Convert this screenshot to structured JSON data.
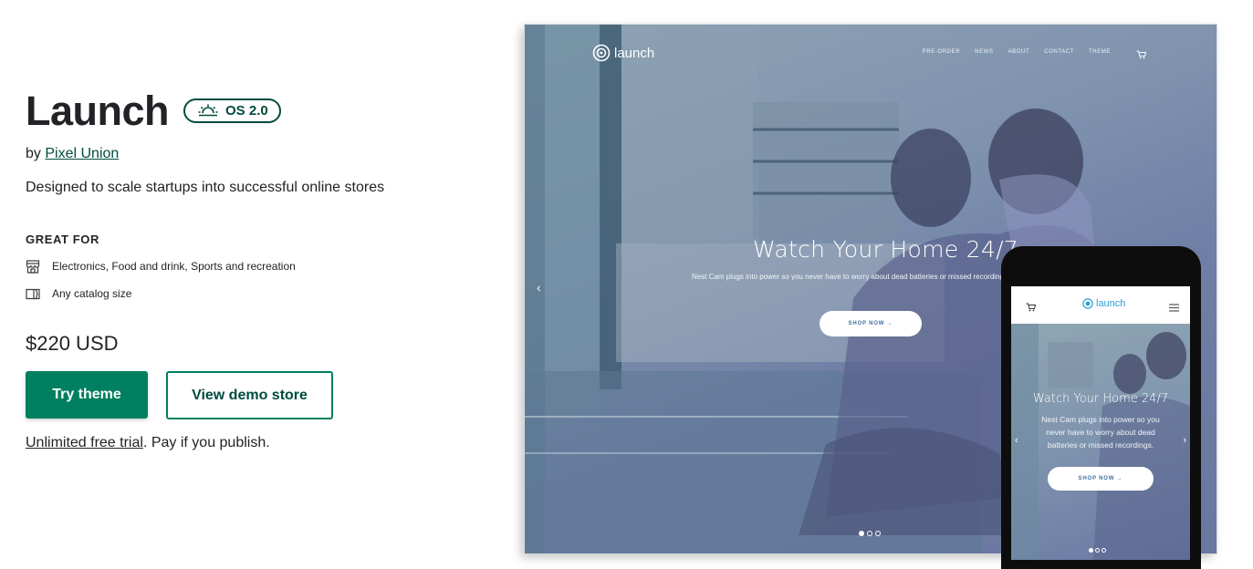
{
  "theme": {
    "name": "Launch",
    "badge": "OS 2.0",
    "by_prefix": "by",
    "author": "Pixel Union",
    "description": "Designed to scale startups into successful online stores"
  },
  "great_for": {
    "heading": "GREAT FOR",
    "items": [
      {
        "icon": "store-icon",
        "text": "Electronics, Food and drink, Sports and recreation"
      },
      {
        "icon": "catalog-icon",
        "text": "Any catalog size"
      }
    ]
  },
  "price": "$220 USD",
  "actions": {
    "try_label": "Try theme",
    "demo_label": "View demo store"
  },
  "trial": {
    "link_text": "Unlimited free trial",
    "rest_text": ". Pay if you publish."
  },
  "preview": {
    "logo": "launch",
    "nav": [
      "PRE-ORDER",
      "NEWS",
      "ABOUT",
      "CONTACT",
      "THEME"
    ],
    "hero_title": "Watch Your Home 24/7",
    "hero_sub": "Nest Cam plugs into power so you never have to worry about dead batteries or missed recordings.",
    "hero_cta": "SHOP NOW →",
    "mobile_hero_title": "Watch Your Home 24/7",
    "mobile_hero_sub": "Nest Cam plugs into power so you never have to worry about dead batteries or missed recordings.",
    "mobile_cta": "SHOP NOW →"
  },
  "colors": {
    "brand_green": "#008060",
    "dark_green": "#004c3f"
  }
}
